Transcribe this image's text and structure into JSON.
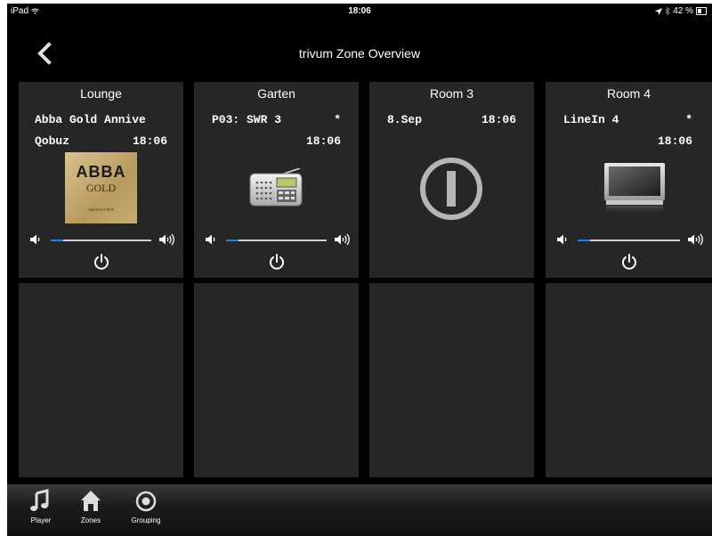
{
  "status_bar": {
    "device": "iPad",
    "time": "18:06",
    "battery_text": "42 %"
  },
  "nav": {
    "title": "trivum Zone Overview"
  },
  "zones": [
    {
      "name": "Lounge",
      "line1_left": "Abba Gold Annive",
      "line1_right": "",
      "line2_left": "Qobuz",
      "line2_right": "18:06",
      "art": "abba-gold-album-cover",
      "art_title": "ABBA",
      "art_sub": "GOLD",
      "art_small": "GREATEST HITS",
      "volume": 0.12
    },
    {
      "name": "Garten",
      "line1_left": "P03: SWR 3",
      "line1_right": "*",
      "line2_left": "",
      "line2_right": "18:06",
      "art": "radio-icon",
      "volume": 0.12
    },
    {
      "name": "Room 3",
      "line1_left": "8.Sep",
      "line1_right": "18:06",
      "line2_left": "",
      "line2_right": "",
      "art": "power-off-icon"
    },
    {
      "name": "Room 4",
      "line1_left": "LineIn 4",
      "line1_right": "*",
      "line2_left": "",
      "line2_right": "18:06",
      "art": "tv-icon",
      "volume": 0.12
    }
  ],
  "tabs": [
    {
      "label": "Player",
      "icon": "music-note-icon"
    },
    {
      "label": "Zones",
      "icon": "house-icon"
    },
    {
      "label": "Grouping",
      "icon": "target-icon"
    }
  ],
  "colors": {
    "tile": "#262626",
    "volume_fill": "#2f7dd8",
    "background": "#000000"
  }
}
